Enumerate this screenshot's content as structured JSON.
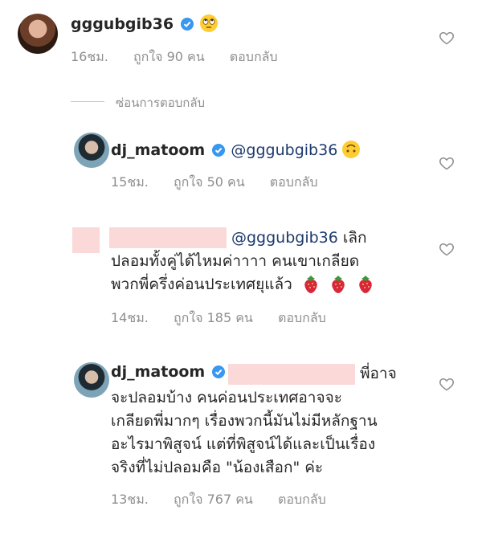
{
  "comments": [
    {
      "username": "gggubgib36",
      "time": "16ชม.",
      "likes": "ถูกใจ 90 คน",
      "reply": "ตอบกลับ",
      "icon": "rolling-eyes-emoji"
    },
    {
      "username": "dj_matoom",
      "mention": "@gggubgib36",
      "time": "15ชม.",
      "likes": "ถูกใจ 50 คน",
      "reply": "ตอบกลับ",
      "icon": "upside-down-face-emoji"
    },
    {
      "mention": "@gggubgib36",
      "text_first": "เลิก",
      "line2": "ปลอมทั้งคู่ได้ไหมค่าาาา คนเขาเกลียด",
      "line3": "พวกพี่ครึ่งค่อนประเทศยุแล้ว",
      "time": "14ชม.",
      "likes": "ถูกใจ 185 คน",
      "reply": "ตอบกลับ",
      "icon": "strawberry-emoji"
    },
    {
      "username": "dj_matoom",
      "text_first": "พี่อาจ",
      "line2": "จะปลอมบ้าง คนค่อนประเทศอาจจะ",
      "line3": "เกลียดพี่มากๆ เรื่องพวกนี้มันไม่มีหลักฐาน",
      "line4": "อะไรมาพิสูจน์ แต่ที่พิสูจน์ได้และเป็นเรื่อง",
      "line5": "จริงที่ไม่ปลอมคือ \"น้องเสือก\" ค่ะ",
      "time": "13ชม.",
      "likes": "ถูกใจ 767 คน",
      "reply": "ตอบกลับ"
    }
  ],
  "hide_replies": "ซ่อนการตอบกลับ",
  "colors": {
    "verified": "#3897f0",
    "mention": "#1d3a6d",
    "meta": "#8e8e8e",
    "redaction": "#fbd9d9"
  }
}
